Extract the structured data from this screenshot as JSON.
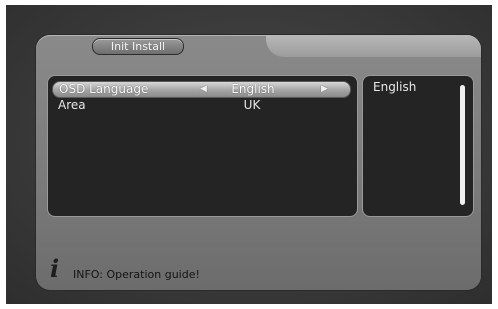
{
  "header": {
    "title": "Init Install"
  },
  "settings": [
    {
      "label": "OSD Language",
      "value": "English",
      "selected": true
    },
    {
      "label": "Area",
      "value": "UK",
      "selected": false
    }
  ],
  "side_panel": {
    "text": "English"
  },
  "footer": {
    "icon": "info-icon",
    "icon_glyph": "i",
    "text": "INFO: Operation guide!"
  }
}
